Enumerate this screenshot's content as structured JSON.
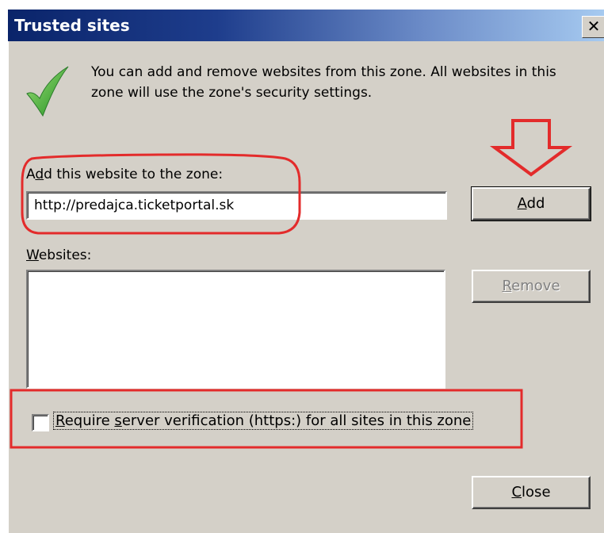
{
  "dialog": {
    "title": "Trusted sites",
    "close_glyph": "✕"
  },
  "info": {
    "icon": "green-checkmark-icon",
    "text": "You can add and remove websites from this zone. All websites in this zone will use the zone's security settings."
  },
  "add_section": {
    "label_prefix": "A",
    "label_accel": "d",
    "label_rest": "d this website to the zone:",
    "input_value": "http://predajca.ticketportal.sk",
    "add_button_accel": "A",
    "add_button_rest": "dd"
  },
  "websites_section": {
    "label_accel": "W",
    "label_rest": "ebsites:",
    "items": [],
    "remove_button_accel": "R",
    "remove_button_rest": "emove"
  },
  "require_https": {
    "label_accel": "R",
    "label_rest1": "equire ",
    "label_accel2": "s",
    "label_rest2": "erver verification (https:) for all sites in this zone",
    "checked": false
  },
  "footer": {
    "close_button_accel": "C",
    "close_button_rest": "lose"
  },
  "annotations": {
    "highlight_color": "#e32b2b",
    "arrow_icon": "down-arrow-annotation-icon"
  }
}
